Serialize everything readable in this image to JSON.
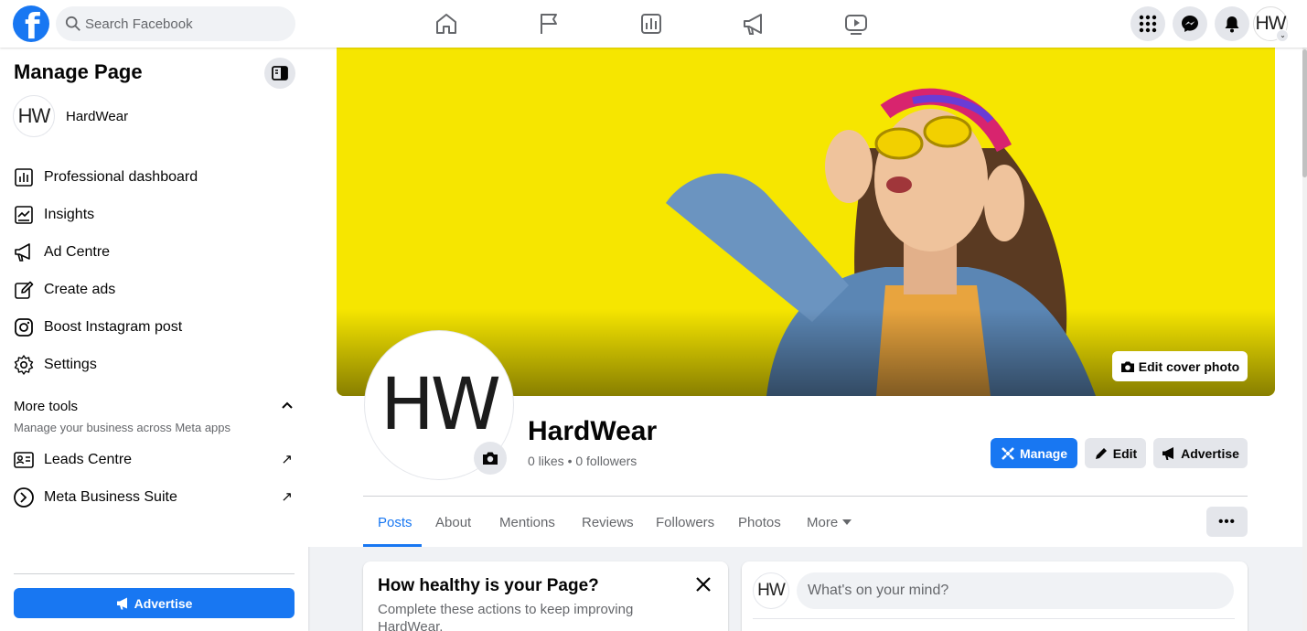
{
  "topbar": {
    "search_placeholder": "Search Facebook",
    "avatar_text": "HW",
    "nav_icons": [
      "home-icon",
      "flag-icon",
      "insights-icon",
      "megaphone-icon",
      "video-icon"
    ],
    "right_icons": [
      "menu-grid-icon",
      "messenger-icon",
      "bell-icon"
    ]
  },
  "sidebar": {
    "title": "Manage Page",
    "page_avatar": "HW",
    "page_name": "HardWear",
    "items": [
      {
        "label": "Professional dashboard",
        "icon": "dashboard-icon"
      },
      {
        "label": "Insights",
        "icon": "insights-icon"
      },
      {
        "label": "Ad Centre",
        "icon": "megaphone-icon"
      },
      {
        "label": "Create ads",
        "icon": "pencil-icon"
      },
      {
        "label": "Boost Instagram post",
        "icon": "instagram-icon"
      },
      {
        "label": "Settings",
        "icon": "gear-icon"
      }
    ],
    "more_tools": {
      "title": "More tools",
      "subtitle": "Manage your business across Meta apps"
    },
    "tools": [
      {
        "label": "Leads Centre",
        "icon": "leads-icon"
      },
      {
        "label": "Meta Business Suite",
        "icon": "business-suite-icon"
      }
    ],
    "advertise_label": "Advertise"
  },
  "profile": {
    "avatar_text": "HW",
    "name": "HardWear",
    "stats": "0 likes • 0 followers",
    "edit_cover_label": "Edit cover photo",
    "manage_label": "Manage",
    "edit_label": "Edit",
    "advertise_label": "Advertise"
  },
  "tabs": [
    "Posts",
    "About",
    "Mentions",
    "Reviews",
    "Followers",
    "Photos",
    "More"
  ],
  "active_tab": "Posts",
  "more_button": "•••",
  "health_card": {
    "title": "How healthy is your Page?",
    "body": "Complete these actions to keep improving HardWear."
  },
  "composer": {
    "avatar_text": "HW",
    "placeholder": "What's on your mind?"
  },
  "colors": {
    "brand": "#1877f2",
    "cover_background": "#f6e600"
  }
}
